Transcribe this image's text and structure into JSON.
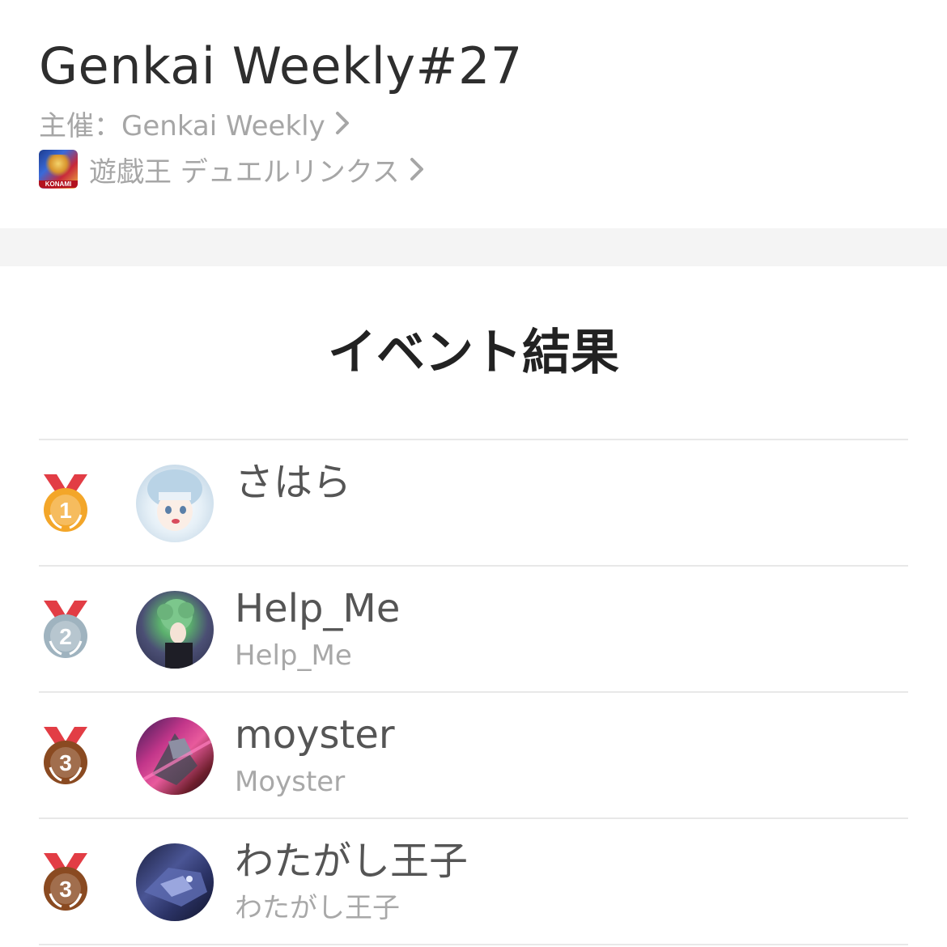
{
  "event": {
    "title": "Genkai Weekly#27",
    "organizer": "主催：Genkai Weekly",
    "game": "遊戯王 デュエルリンクス",
    "game_icon_brand": "KONAMI"
  },
  "results": {
    "heading": "イベント結果",
    "players": [
      {
        "rank": "1",
        "name": "さはら",
        "sub": "",
        "medal_color": "#f3a629",
        "avatar_icon": "anime-girl-avatar"
      },
      {
        "rank": "2",
        "name": "Help_Me",
        "sub": "Help_Me",
        "medal_color": "#9fb3bf",
        "avatar_icon": "green-hair-character-avatar"
      },
      {
        "rank": "3",
        "name": "moyster",
        "sub": "Moyster",
        "medal_color": "#8a4a21",
        "avatar_icon": "robot-artwork-avatar"
      },
      {
        "rank": "3",
        "name": "わたがし王子",
        "sub": "わたがし王子",
        "medal_color": "#8a4a21",
        "avatar_icon": "mecha-dragon-avatar"
      }
    ]
  },
  "colors": {
    "ribbon": "#e23d45",
    "band": "#f4f4f4",
    "divider": "#e8e8e8",
    "muted_text": "#a6a6a6"
  }
}
